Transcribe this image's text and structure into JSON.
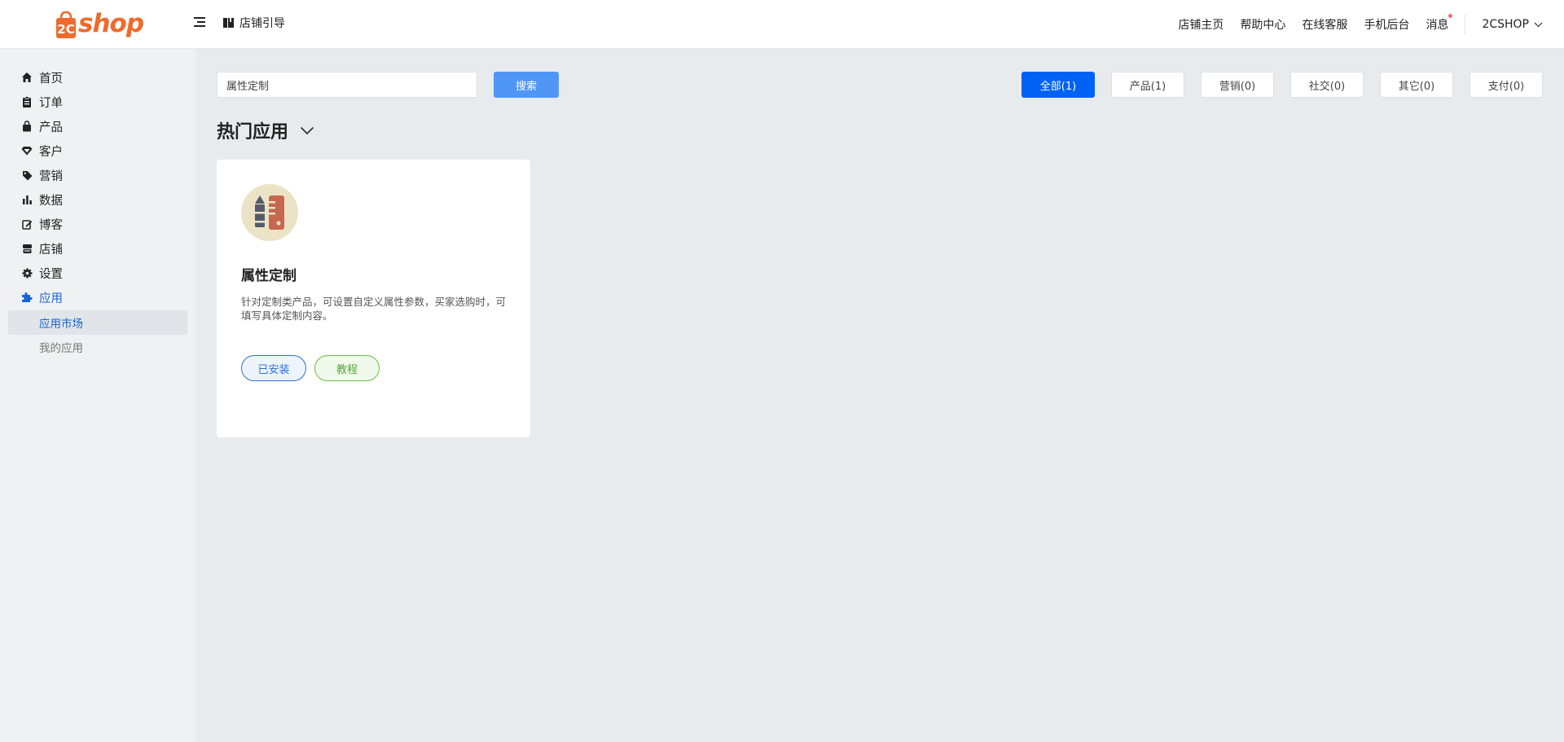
{
  "header": {
    "logo_text": "shop",
    "logo_mark_text": "2C",
    "brand_color": "#ef6a2d",
    "guide_label": "店铺引导",
    "nav": [
      "店铺主页",
      "帮助中心",
      "在线客服",
      "手机后台"
    ],
    "message_label": "消息",
    "has_unread_messages": true,
    "account_name": "2CSHOP"
  },
  "sidebar": {
    "items": [
      {
        "label": "首页",
        "icon": "home-icon"
      },
      {
        "label": "订单",
        "icon": "clipboard-icon"
      },
      {
        "label": "产品",
        "icon": "bag-icon"
      },
      {
        "label": "客户",
        "icon": "diamond-icon"
      },
      {
        "label": "营销",
        "icon": "tag-icon"
      },
      {
        "label": "数据",
        "icon": "bar-chart-icon"
      },
      {
        "label": "博客",
        "icon": "edit-icon"
      },
      {
        "label": "店铺",
        "icon": "store-icon"
      },
      {
        "label": "设置",
        "icon": "gear-icon"
      },
      {
        "label": "应用",
        "icon": "puzzle-icon"
      }
    ],
    "active_item": "应用",
    "sub_items": [
      {
        "label": "应用市场",
        "active": true
      },
      {
        "label": "我的应用",
        "active": false
      }
    ],
    "accent_color": "#1764d4"
  },
  "search": {
    "value": "属性定制",
    "button_label": "搜索"
  },
  "filters": [
    {
      "label": "全部(1)",
      "active": true
    },
    {
      "label": "产品(1)",
      "active": false
    },
    {
      "label": "营销(0)",
      "active": false
    },
    {
      "label": "社交(0)",
      "active": false
    },
    {
      "label": "其它(0)",
      "active": false
    },
    {
      "label": "支付(0)",
      "active": false
    }
  ],
  "section_title": "热门应用",
  "apps": [
    {
      "name": "属性定制",
      "icon": "pencil-ruler-icon",
      "description": "针对定制类产品，可设置自定义属性参数，买家选购时，可填写具体定制内容。",
      "installed_label": "已安装",
      "tutorial_label": "教程"
    }
  ]
}
